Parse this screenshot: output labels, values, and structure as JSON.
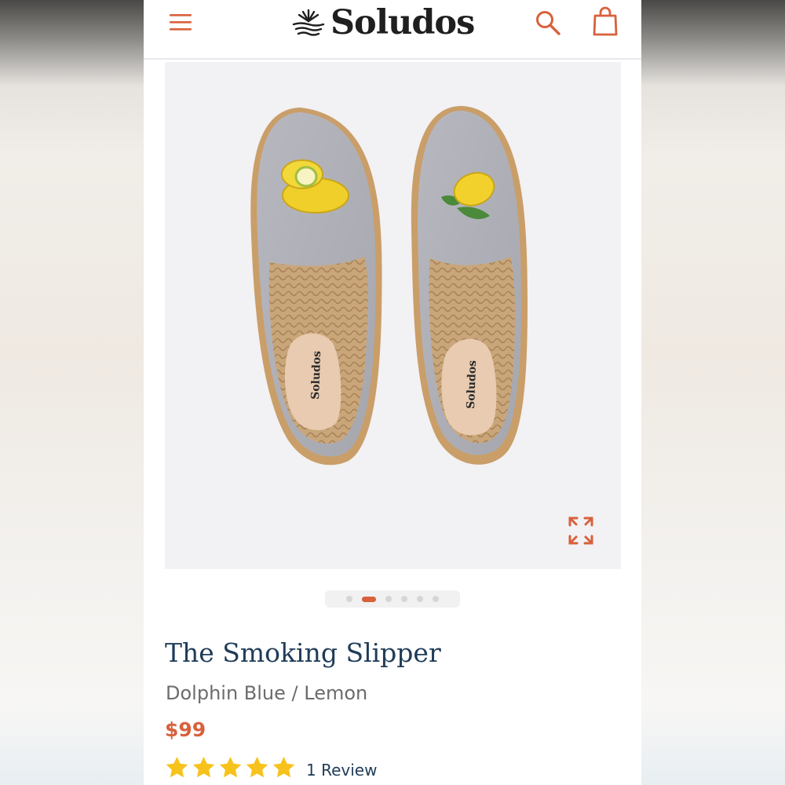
{
  "brand": {
    "name": "Soludos",
    "accent_color": "#d8613c",
    "navy_color": "#1f3c58"
  },
  "header": {
    "menu_icon": "hamburger-menu-icon",
    "search_icon": "search-icon",
    "bag_icon": "shopping-bag-icon"
  },
  "product": {
    "title": "The Smoking Slipper",
    "variant": "Dolphin Blue / Lemon",
    "price": "$99",
    "rating": 5,
    "rating_max": 5,
    "review_text": "1 Review",
    "insole_brand": "Soludos"
  },
  "gallery": {
    "image_count": 6,
    "active_index": 1,
    "expand_icon": "expand-icon"
  }
}
